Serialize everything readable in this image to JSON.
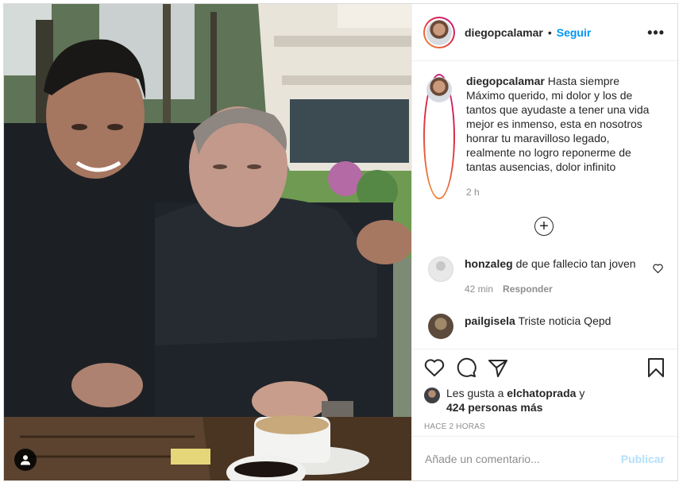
{
  "post": {
    "author": "diegopcalamar",
    "follow_label": "Seguir",
    "separator": "•",
    "more_label": "•••",
    "caption": "Hasta siempre\nMáximo querido, mi dolor y los de\ntantos que ayudaste a tener una vida\nmejor es inmenso, esta en nosotros\nhonrar tu maravilloso legado,\nrealmente no logro reponerme de\ntantas ausencias, dolor infinito",
    "caption_time": "2 h"
  },
  "comments": [
    {
      "user": "honzaleg",
      "text": "de que fallecio tan joven",
      "time": "42 min",
      "reply_label": "Responder"
    },
    {
      "user": "pailgisela",
      "text": "Triste noticia Qepd"
    }
  ],
  "likes": {
    "prefix": "Les gusta a",
    "first_user": "elchatoprada",
    "connector": "y",
    "others": "424 personas más"
  },
  "post_time": "HACE 2 HORAS",
  "comment_box": {
    "placeholder": "Añade un comentario...",
    "publish_label": "Publicar"
  },
  "icons": {
    "like": "heart-icon",
    "comment": "comment-icon",
    "share": "share-icon",
    "save": "bookmark-icon",
    "tags": "user-tag-icon",
    "load_more": "plus-circle-icon"
  },
  "colors": {
    "accent": "#0095f6",
    "publish_disabled": "#b2dffc",
    "muted": "#8e8e8e",
    "text": "#262626"
  }
}
